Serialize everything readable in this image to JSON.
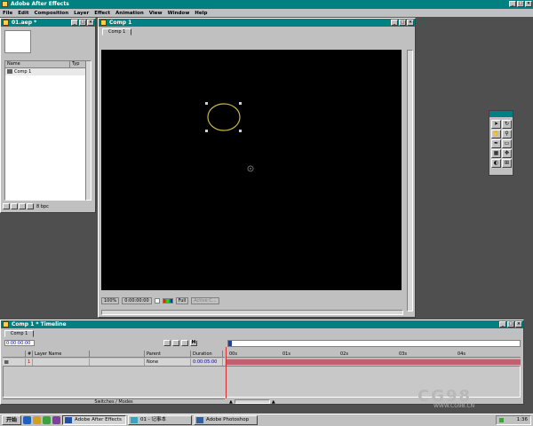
{
  "app": {
    "title": "Adobe After Effects",
    "menus": [
      "File",
      "Edit",
      "Composition",
      "Layer",
      "Effect",
      "Animation",
      "View",
      "Window",
      "Help"
    ]
  },
  "project": {
    "title": "01.aep *",
    "columns": [
      "Name",
      "Typ"
    ],
    "item": "Comp 1",
    "footer": "8 bpc"
  },
  "comp": {
    "title": "Comp 1",
    "tab": "Comp 1",
    "zoom": "100%",
    "timecode": "0:00:00:00",
    "resolution": "Full",
    "camera": "Active C..."
  },
  "toolbox": {
    "tools": [
      "arrow-icon",
      "rotate-icon",
      "hand-icon",
      "zoom-icon",
      "pen-icon",
      "mask-icon",
      "text-icon",
      "pan-icon",
      "orbit-icon",
      "track-icon"
    ]
  },
  "timeline": {
    "title": "Comp 1 * Timeline",
    "tab": "Comp 1",
    "time": "0:00:00:00",
    "columns": [
      "#",
      "Layer Name",
      "Parent",
      "Duration"
    ],
    "layer": {
      "number": "1",
      "name": "",
      "parent": "None",
      "duration": "0:00:05:00"
    },
    "ruler": [
      "00s",
      "01s",
      "02s",
      "03s",
      "04s"
    ],
    "switch_label": "Switches / Modes"
  },
  "watermark": {
    "brand": "CG98",
    "url": "WWW.CG98.CN"
  },
  "taskbar": {
    "start": "开始",
    "tasks": [
      "Adobe After Effects",
      "01 - 记事本",
      "Adobe Photoshop"
    ],
    "clock": "1:36"
  },
  "colors": {
    "titlebar": "#008080",
    "ellipse": "#c8b848",
    "layer_bar": "#c06070"
  }
}
